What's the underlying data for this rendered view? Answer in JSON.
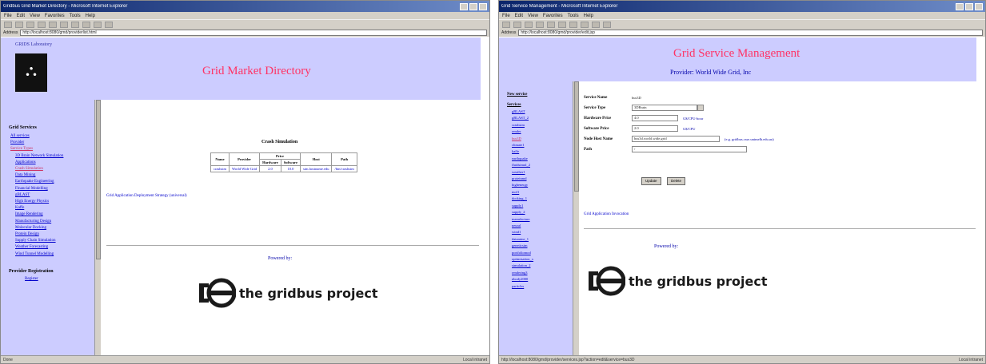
{
  "win1": {
    "title_bar": "Gridbus Grid Market Directory - Microsoft Internet Explorer",
    "menu": [
      "File",
      "Edit",
      "View",
      "Favorites",
      "Tools",
      "Help"
    ],
    "address_label": "Address",
    "address": "http://localhost:8080/gmd/providerlist.html",
    "lab_name": "GRIDS Laboratory",
    "page_title": "Grid Market Directory",
    "sidebar": {
      "heading": "Grid Services",
      "items": [
        {
          "label": "All services",
          "indent": false,
          "active": false
        },
        {
          "label": "Provider",
          "indent": false,
          "active": false
        },
        {
          "label": "Service Types",
          "indent": false,
          "active": true
        },
        {
          "label": "3D Brain Network Simulation",
          "indent": true,
          "active": false
        },
        {
          "label": "Applications",
          "indent": true,
          "active": false
        },
        {
          "label": "Crash Simulation",
          "indent": true,
          "active": true
        },
        {
          "label": "Data Mining",
          "indent": true,
          "active": false
        },
        {
          "label": "Earthquake Engineering",
          "indent": true,
          "active": false
        },
        {
          "label": "Financial Modelling",
          "indent": true,
          "active": false
        },
        {
          "label": "gBLAST",
          "indent": true,
          "active": false
        },
        {
          "label": "High Energy Physics",
          "indent": true,
          "active": false
        },
        {
          "label": "Kaffe",
          "indent": true,
          "active": false
        },
        {
          "label": "Image Rendering",
          "indent": true,
          "active": false
        },
        {
          "label": "Manufacturing Design",
          "indent": true,
          "active": false
        },
        {
          "label": "Molecular Docking",
          "indent": true,
          "active": false
        },
        {
          "label": "Protein Design",
          "indent": true,
          "active": false
        },
        {
          "label": "Supply Chain Simulation",
          "indent": true,
          "active": false
        },
        {
          "label": "Weather Forecasting",
          "indent": true,
          "active": false
        },
        {
          "label": "Wind Tunnel Modelling",
          "indent": true,
          "active": false
        }
      ],
      "heading2": "Provider Registration",
      "items2": [
        "Register"
      ]
    },
    "table": {
      "title": "Crash Simulation",
      "headers": [
        "Name",
        "Provider",
        "Price",
        "Hardware",
        "Software",
        "Host",
        "Path"
      ],
      "row": [
        "crashsim",
        "World Wide Grid",
        "2.0",
        "10.0",
        "sim.hostname.edu",
        "/bin/crashsim"
      ]
    },
    "link_text": "Grid Application Deployment Strategy (universal)",
    "powered_by": "Powered by:",
    "logo_text": "the gridbus project",
    "status_left": "Done",
    "status_right": "Local intranet"
  },
  "win2": {
    "title_bar": "Grid Service Management - Microsoft Internet Explorer",
    "menu": [
      "File",
      "Edit",
      "View",
      "Favorites",
      "Tools",
      "Help"
    ],
    "address_label": "Address",
    "address": "http://localhost:8080/gmd/provider/edit.jsp",
    "page_title": "Grid Service Management",
    "provider": "Provider: World Wide Grid, Inc",
    "sidebar": {
      "heading": "New service",
      "heading2": "Services",
      "items": [
        {
          "label": "gBLAST",
          "active": false
        },
        {
          "label": "gBLAST_2",
          "active": false
        },
        {
          "label": "crashsim",
          "active": false
        },
        {
          "label": "render",
          "active": false
        },
        {
          "label": "bus3D",
          "active": true
        },
        {
          "label": "climate1",
          "active": false
        },
        {
          "label": "kaffe",
          "active": false
        },
        {
          "label": "earthquake",
          "active": false
        },
        {
          "label": "fluidsimul_2",
          "active": false
        },
        {
          "label": "weather1",
          "active": false
        },
        {
          "label": "proteinmd",
          "active": false
        },
        {
          "label": "highenergy",
          "active": false
        },
        {
          "label": "mol1",
          "active": false
        },
        {
          "label": "docking_1",
          "active": false
        },
        {
          "label": "supply1",
          "active": false
        },
        {
          "label": "supply_2",
          "active": false
        },
        {
          "label": "manufacture",
          "active": false
        },
        {
          "label": "neural",
          "active": false
        },
        {
          "label": "wind1",
          "active": false
        },
        {
          "label": "datamine_1",
          "active": false
        },
        {
          "label": "geneticsim",
          "active": false
        },
        {
          "label": "portfoliomod",
          "active": false
        },
        {
          "label": "optimisation_x",
          "active": false
        },
        {
          "label": "simulation_2",
          "active": false
        },
        {
          "label": "rendering3",
          "active": false
        },
        {
          "label": "nbody2000",
          "active": false
        },
        {
          "label": "particles",
          "active": false
        }
      ]
    },
    "form": {
      "service_name_label": "Service Name",
      "service_name": "bus3D",
      "service_type_label": "Service Type",
      "service_type": "3DBrain",
      "hardware_price_label": "Hardware Price",
      "hardware_price": "4.0",
      "hardware_unit": "G$/CPU-hour",
      "software_price_label": "Software Price",
      "software_price": "2.0",
      "software_unit": "G$/CPU",
      "node_host_label": "Node Host Name",
      "node_host": "bus3d.world.wide.grid",
      "node_host_hint": "(e.g. gridbus.csse.unimelb.edu.au)",
      "path_label": "Path",
      "path": "/",
      "update_button": "Update",
      "delete_button": "Delete"
    },
    "link_text": "Grid Application Invocation",
    "powered_by": "Powered by:",
    "logo_text": "the gridbus project",
    "status_left": "http://localhost:8080/gmd/provider/services.jsp?action=edit&service=bus3D",
    "status_right": "Local intranet"
  }
}
